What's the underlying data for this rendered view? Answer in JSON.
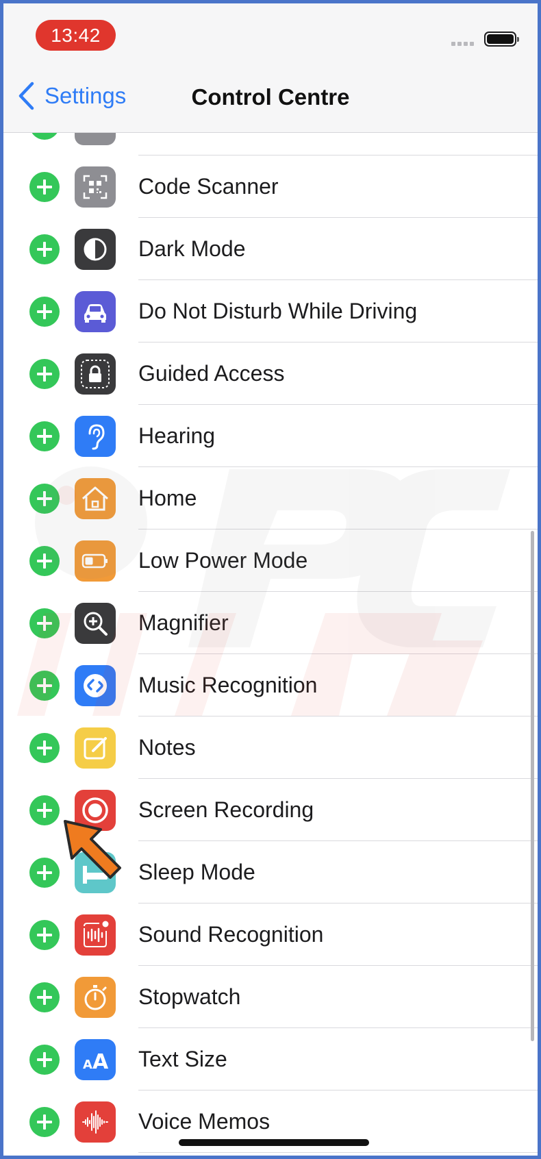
{
  "status": {
    "time": "13:42"
  },
  "nav": {
    "back_label": "Settings",
    "title": "Control Centre"
  },
  "colors": {
    "add_green": "#34c759",
    "accent_blue": "#2f7cf6",
    "frame_blue": "#4a74c9",
    "arrow_orange": "#ef7b1f"
  },
  "items": [
    {
      "label": "",
      "icon": "partial-gray-icon",
      "tile_color": "#8e8e93"
    },
    {
      "label": "Code Scanner",
      "icon": "qr-code-icon",
      "tile_color": "#8e8e93"
    },
    {
      "label": "Dark Mode",
      "icon": "dark-mode-icon",
      "tile_color": "#3a3a3c"
    },
    {
      "label": "Do Not Disturb While Driving",
      "icon": "car-icon",
      "tile_color": "#5b5bd6"
    },
    {
      "label": "Guided Access",
      "icon": "lock-icon",
      "tile_color": "#3a3a3c"
    },
    {
      "label": "Hearing",
      "icon": "ear-icon",
      "tile_color": "#2f7cf6"
    },
    {
      "label": "Home",
      "icon": "house-icon",
      "tile_color": "#f19a38"
    },
    {
      "label": "Low Power Mode",
      "icon": "battery-icon",
      "tile_color": "#f19a38"
    },
    {
      "label": "Magnifier",
      "icon": "magnifier-icon",
      "tile_color": "#3a3a3c"
    },
    {
      "label": "Music Recognition",
      "icon": "shazam-icon",
      "tile_color": "#2f7cf6"
    },
    {
      "label": "Notes",
      "icon": "note-icon",
      "tile_color": "#f5cd47"
    },
    {
      "label": "Screen Recording",
      "icon": "record-icon",
      "tile_color": "#e3403a"
    },
    {
      "label": "Sleep Mode",
      "icon": "bed-icon",
      "tile_color": "#5ec7c9"
    },
    {
      "label": "Sound Recognition",
      "icon": "waveform-icon",
      "tile_color": "#e3403a"
    },
    {
      "label": "Stopwatch",
      "icon": "stopwatch-icon",
      "tile_color": "#f19a38"
    },
    {
      "label": "Text Size",
      "icon": "text-size-icon",
      "tile_color": "#2f7cf6"
    },
    {
      "label": "Voice Memos",
      "icon": "voice-memo-icon",
      "tile_color": "#e3403a"
    }
  ]
}
